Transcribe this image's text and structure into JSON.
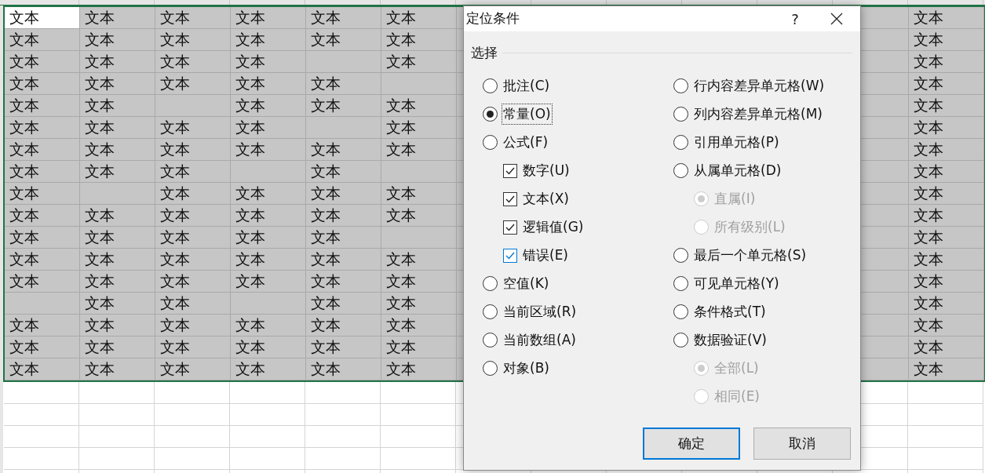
{
  "sheet": {
    "rows": [
      {
        "cells": [
          {
            "text": "文本",
            "active": true
          },
          {
            "text": "文本"
          },
          {
            "text": "文本"
          },
          {
            "text": "文本"
          },
          {
            "text": "文本"
          },
          {
            "text": "文本"
          },
          {
            "text": "文本"
          }
        ]
      },
      {
        "cells": [
          {
            "text": "文本"
          },
          {
            "text": "文本"
          },
          {
            "text": "文本"
          },
          {
            "text": "文本"
          },
          {
            "text": "文本"
          },
          {
            "text": "文本"
          },
          {
            "text": "文本"
          }
        ]
      },
      {
        "cells": [
          {
            "text": "文本"
          },
          {
            "text": "文本"
          },
          {
            "text": "文本"
          },
          {
            "text": "文本"
          },
          {},
          {
            "text": "文本"
          },
          {
            "text": "文本"
          }
        ]
      },
      {
        "cells": [
          {
            "text": "文本"
          },
          {
            "text": "文本"
          },
          {
            "text": "文本"
          },
          {
            "text": "文本"
          },
          {
            "text": "文本"
          },
          {},
          {
            "text": "文本"
          }
        ]
      },
      {
        "cells": [
          {
            "text": "文本"
          },
          {
            "text": "文本"
          },
          {},
          {
            "text": "文本"
          },
          {
            "text": "文本"
          },
          {
            "text": "文本"
          },
          {
            "text": "文本"
          }
        ]
      },
      {
        "cells": [
          {
            "text": "文本"
          },
          {
            "text": "文本"
          },
          {
            "text": "文本"
          },
          {
            "text": "文本"
          },
          {},
          {
            "text": "文本"
          },
          {
            "text": "文本"
          }
        ]
      },
      {
        "cells": [
          {
            "text": "文本"
          },
          {
            "text": "文本"
          },
          {
            "text": "文本"
          },
          {
            "text": "文本"
          },
          {
            "text": "文本"
          },
          {
            "text": "文本"
          },
          {
            "text": "文本"
          }
        ]
      },
      {
        "cells": [
          {
            "text": "文本"
          },
          {
            "text": "文本"
          },
          {
            "text": "文本"
          },
          {},
          {
            "text": "文本"
          },
          {},
          {
            "text": "文本"
          }
        ]
      },
      {
        "cells": [
          {
            "text": "文本"
          },
          {},
          {
            "text": "文本"
          },
          {
            "text": "文本"
          },
          {
            "text": "文本"
          },
          {
            "text": "文本"
          },
          {
            "text": "文本"
          }
        ]
      },
      {
        "cells": [
          {
            "text": "文本"
          },
          {
            "text": "文本"
          },
          {
            "text": "文本"
          },
          {
            "text": "文本"
          },
          {
            "text": "文本"
          },
          {
            "text": "文本"
          },
          {
            "text": "文本"
          }
        ]
      },
      {
        "cells": [
          {
            "text": "文本"
          },
          {
            "text": "文本"
          },
          {
            "text": "文本"
          },
          {
            "text": "文本"
          },
          {
            "text": "文本"
          },
          {},
          {
            "text": "文本"
          }
        ]
      },
      {
        "cells": [
          {
            "text": "文本"
          },
          {
            "text": "文本"
          },
          {
            "text": "文本"
          },
          {
            "text": "文本"
          },
          {
            "text": "文本"
          },
          {
            "text": "文本"
          },
          {
            "text": "文本"
          }
        ]
      },
      {
        "cells": [
          {
            "text": "文本"
          },
          {
            "text": "文本"
          },
          {
            "text": "文本"
          },
          {
            "text": "文本"
          },
          {
            "text": "文本"
          },
          {
            "text": "文本"
          },
          {
            "text": "文本"
          }
        ]
      },
      {
        "cells": [
          {},
          {
            "text": "文本"
          },
          {
            "text": "文本"
          },
          {},
          {
            "text": "文本"
          },
          {
            "text": "文本"
          },
          {
            "text": "文本"
          }
        ]
      },
      {
        "cells": [
          {
            "text": "文本"
          },
          {
            "text": "文本"
          },
          {
            "text": "文本"
          },
          {
            "text": "文本"
          },
          {
            "text": "文本"
          },
          {
            "text": "文本"
          },
          {
            "text": "文本"
          }
        ]
      },
      {
        "cells": [
          {
            "text": "文本"
          },
          {
            "text": "文本"
          },
          {
            "text": "文本"
          },
          {
            "text": "文本"
          },
          {
            "text": "文本"
          },
          {
            "text": "文本"
          },
          {
            "text": "文本"
          }
        ]
      },
      {
        "cells": [
          {
            "text": "文本"
          },
          {
            "text": "文本"
          },
          {
            "text": "文本"
          },
          {
            "text": "文本"
          },
          {
            "text": "文本"
          },
          {
            "text": "文本"
          },
          {
            "text": "文本"
          }
        ]
      }
    ]
  },
  "dialog": {
    "title": "定位条件",
    "help": "?",
    "group": "选择",
    "left": [
      {
        "kind": "radio",
        "label": "批注(C)",
        "selected": false
      },
      {
        "kind": "radio",
        "label": "常量(O)",
        "selected": true,
        "focused": true
      },
      {
        "kind": "radio",
        "label": "公式(F)",
        "selected": false,
        "children": [
          {
            "kind": "checkbox",
            "label": "数字(U)",
            "checked": true
          },
          {
            "kind": "checkbox",
            "label": "文本(X)",
            "checked": true
          },
          {
            "kind": "checkbox",
            "label": "逻辑值(G)",
            "checked": true
          },
          {
            "kind": "checkbox",
            "label": "错误(E)",
            "checked": true,
            "hovered": true
          }
        ]
      },
      {
        "kind": "radio",
        "label": "空值(K)",
        "selected": false
      },
      {
        "kind": "radio",
        "label": "当前区域(R)",
        "selected": false
      },
      {
        "kind": "radio",
        "label": "当前数组(A)",
        "selected": false
      },
      {
        "kind": "radio",
        "label": "对象(B)",
        "selected": false
      }
    ],
    "right": [
      {
        "kind": "radio",
        "label": "行内容差异单元格(W)",
        "selected": false
      },
      {
        "kind": "radio",
        "label": "列内容差异单元格(M)",
        "selected": false
      },
      {
        "kind": "radio",
        "label": "引用单元格(P)",
        "selected": false
      },
      {
        "kind": "radio",
        "label": "从属单元格(D)",
        "selected": false,
        "children": [
          {
            "kind": "radio",
            "label": "直属(I)",
            "selected": true,
            "disabled": true
          },
          {
            "kind": "radio",
            "label": "所有级别(L)",
            "selected": false,
            "disabled": true
          }
        ]
      },
      {
        "kind": "radio",
        "label": "最后一个单元格(S)",
        "selected": false
      },
      {
        "kind": "radio",
        "label": "可见单元格(Y)",
        "selected": false
      },
      {
        "kind": "radio",
        "label": "条件格式(T)",
        "selected": false
      },
      {
        "kind": "radio",
        "label": "数据验证(V)",
        "selected": false,
        "children": [
          {
            "kind": "radio",
            "label": "全部(L)",
            "selected": true,
            "disabled": true
          },
          {
            "kind": "radio",
            "label": "相同(E)",
            "selected": false,
            "disabled": true
          }
        ]
      }
    ],
    "buttons": [
      {
        "label": "确定",
        "default": true
      },
      {
        "label": "取消",
        "default": false
      }
    ]
  }
}
